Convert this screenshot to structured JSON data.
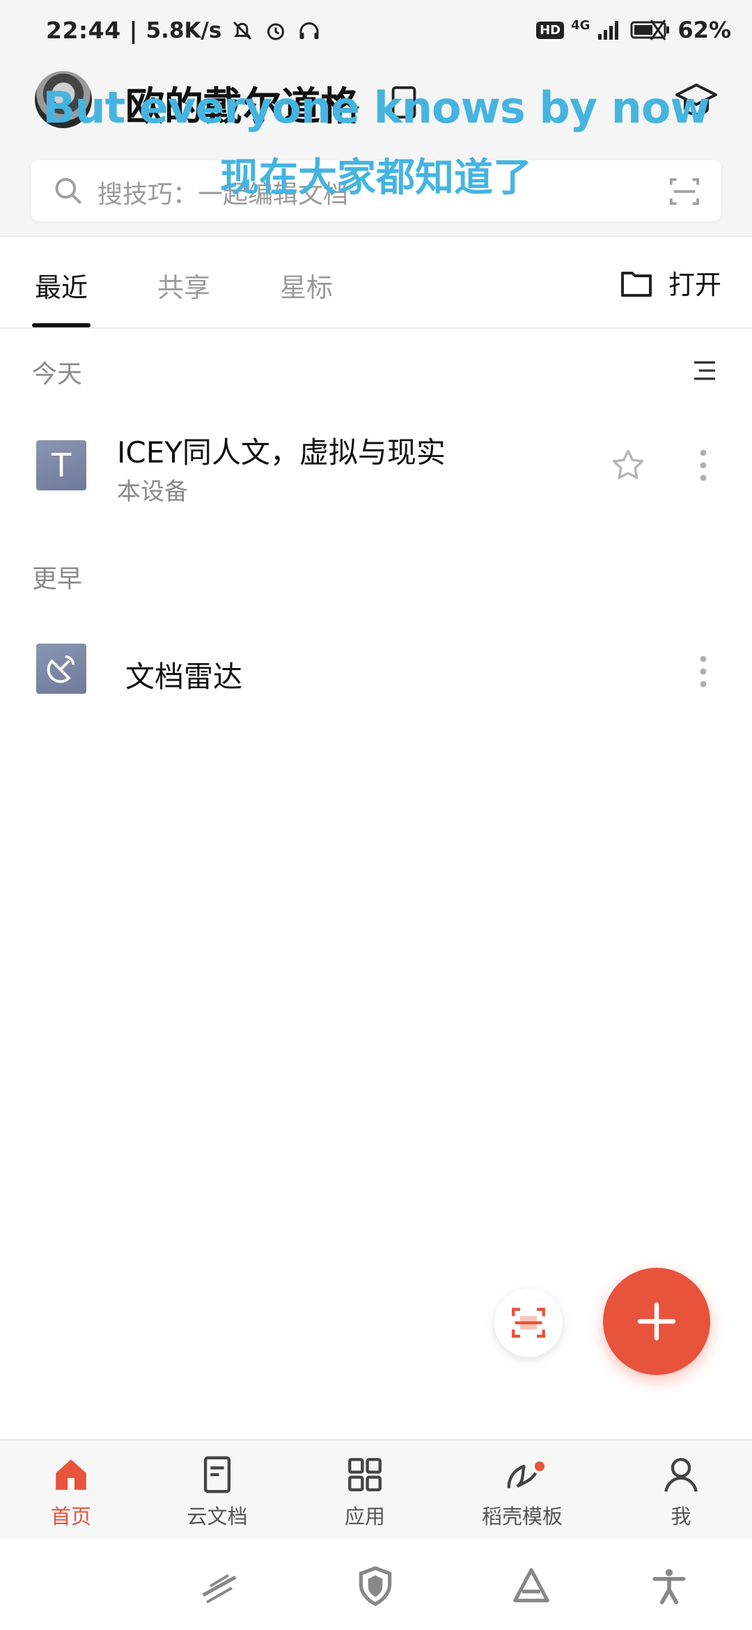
{
  "status_bar": {
    "time": "22:44",
    "separator": "|",
    "net_speed": "5.8K/s",
    "network": "4G",
    "hd": "HD",
    "battery": "62%"
  },
  "header": {
    "username": "欧的戴尔道格",
    "subtitle_en": "But everyone knows by now",
    "subtitle_zh": "现在大家都知道了"
  },
  "search": {
    "placeholder": "搜技巧：一起编辑文档"
  },
  "tabs": {
    "items": [
      {
        "label": "最近",
        "active": true
      },
      {
        "label": "共享",
        "active": false
      },
      {
        "label": "星标",
        "active": false
      }
    ],
    "open_label": "打开"
  },
  "sections": {
    "today_label": "今天",
    "earlier_label": "更早"
  },
  "files": {
    "today": [
      {
        "thumb": "T",
        "name": "ICEY同人文，虚拟与现实",
        "location": "本设备"
      }
    ],
    "earlier": [
      {
        "name": "文档雷达"
      }
    ]
  },
  "bottom_nav": {
    "items": [
      {
        "label": "首页",
        "icon": "home-icon",
        "active": true
      },
      {
        "label": "云文档",
        "icon": "cloud-doc-icon",
        "active": false
      },
      {
        "label": "应用",
        "icon": "apps-icon",
        "active": false
      },
      {
        "label": "稻壳模板",
        "icon": "template-icon",
        "active": false
      },
      {
        "label": "我",
        "icon": "profile-icon",
        "active": false
      }
    ]
  },
  "colors": {
    "accent": "#e8533b",
    "subtitle": "#45b4e0",
    "thumb": "#7d88a6"
  }
}
